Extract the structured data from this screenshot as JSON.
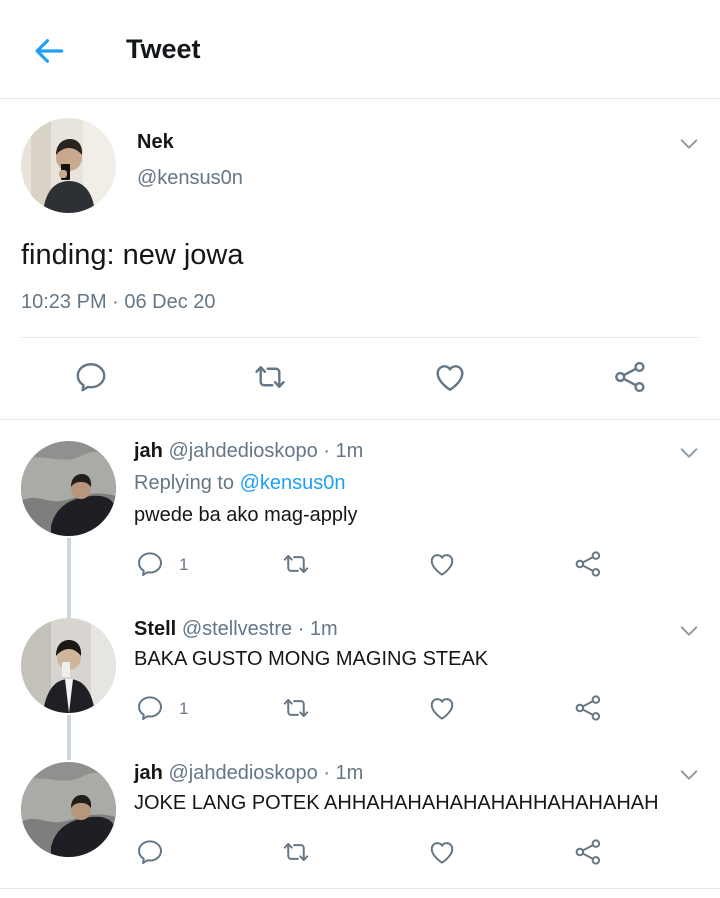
{
  "header": {
    "title": "Tweet"
  },
  "main_tweet": {
    "name": "Nek",
    "handle": "@kensus0n",
    "text": "finding: new jowa",
    "timestamp": "10:23 PM · 06 Dec 20"
  },
  "replies": [
    {
      "name": "jah",
      "meta": "@jahdedioskopo · 1m",
      "replying_prefix": "Replying to ",
      "replying_to": "@kensus0n",
      "text": "pwede ba ako mag-apply",
      "reply_count": "1"
    },
    {
      "name": "Stell",
      "meta": "@stellvestre · 1m",
      "text": "BAKA GUSTO MONG MAGING STEAK",
      "reply_count": "1"
    },
    {
      "name": "jah",
      "meta": "@jahdedioskopo · 1m",
      "text": "JOKE LANG POTEK AHHAHAHAHAHAHAHHAHAHAHAH"
    }
  ],
  "colors": {
    "accent": "#1da1f2",
    "icon": "#657786",
    "secondary_text": "#657786",
    "divider": "#e1e8ed"
  },
  "icons": [
    "back-arrow-icon",
    "chevron-down-icon",
    "reply-icon",
    "retweet-icon",
    "like-icon",
    "share-icon"
  ]
}
